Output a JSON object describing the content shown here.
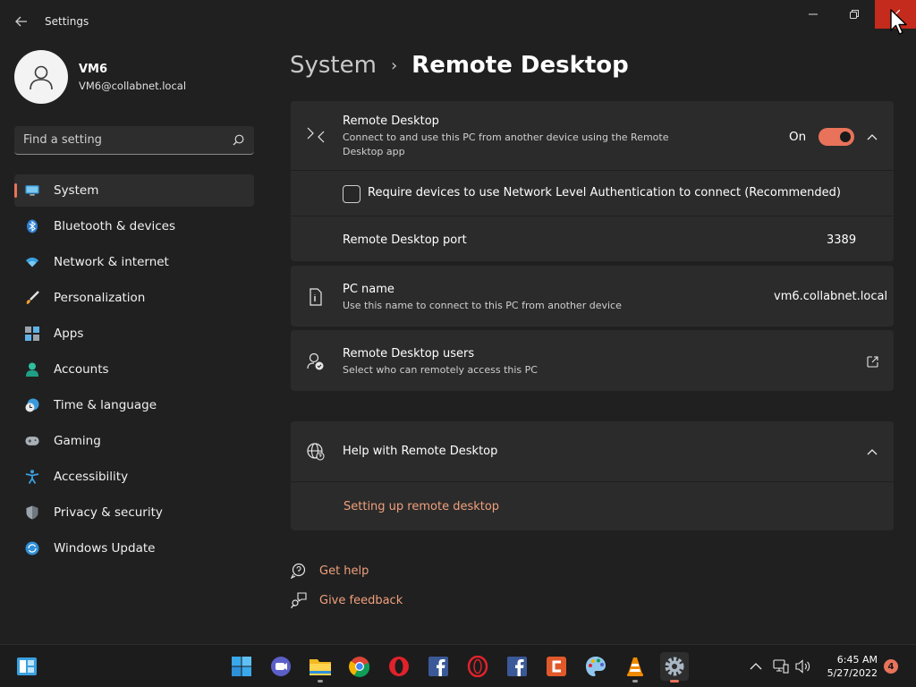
{
  "window": {
    "title": "Settings",
    "back_icon": "arrow-left-icon",
    "minimize_icon": "minimize-icon",
    "maximize_icon": "restore-icon",
    "close_icon": "close-icon"
  },
  "profile": {
    "name": "VM6",
    "email": "VM6@collabnet.local",
    "avatar_icon": "person-icon"
  },
  "search": {
    "placeholder": "Find a setting",
    "icon": "search-icon"
  },
  "sidebar": {
    "items": [
      {
        "label": "System",
        "icon": "monitor-icon",
        "active": true
      },
      {
        "label": "Bluetooth & devices",
        "icon": "bluetooth-icon"
      },
      {
        "label": "Network & internet",
        "icon": "wifi-icon"
      },
      {
        "label": "Personalization",
        "icon": "brush-icon"
      },
      {
        "label": "Apps",
        "icon": "apps-icon"
      },
      {
        "label": "Accounts",
        "icon": "account-icon"
      },
      {
        "label": "Time & language",
        "icon": "clock-globe-icon"
      },
      {
        "label": "Gaming",
        "icon": "gamepad-icon"
      },
      {
        "label": "Accessibility",
        "icon": "accessibility-icon"
      },
      {
        "label": "Privacy & security",
        "icon": "shield-icon"
      },
      {
        "label": "Windows Update",
        "icon": "update-icon"
      }
    ]
  },
  "breadcrumb": {
    "parent": "System",
    "separator": "›",
    "current": "Remote Desktop"
  },
  "remote_desktop": {
    "title": "Remote Desktop",
    "subtitle": "Connect to and use this PC from another device using the Remote Desktop app",
    "toggle_label": "On",
    "toggle_on": true,
    "nla_label": "Require devices to use Network Level Authentication to connect (Recommended)",
    "nla_checked": false,
    "port_label": "Remote Desktop port",
    "port_value": "3389"
  },
  "pc_name": {
    "title": "PC name",
    "subtitle": "Use this name to connect to this PC from another device",
    "value": "vm6.collabnet.local"
  },
  "rd_users": {
    "title": "Remote Desktop users",
    "subtitle": "Select who can remotely access this PC"
  },
  "help": {
    "title": "Help with Remote Desktop",
    "link": "Setting up remote desktop"
  },
  "footer_links": {
    "get_help": "Get help",
    "give_feedback": "Give feedback"
  },
  "taskbar": {
    "apps": [
      {
        "name": "start-icon"
      },
      {
        "name": "widgets-icon"
      },
      {
        "name": "teams-chat-icon"
      },
      {
        "name": "file-explorer-icon"
      },
      {
        "name": "chrome-icon"
      },
      {
        "name": "opera-icon"
      },
      {
        "name": "facebook-icon"
      },
      {
        "name": "opera-gx-icon"
      },
      {
        "name": "facebook-icon"
      },
      {
        "name": "ccleaner-icon"
      },
      {
        "name": "paint-icon"
      },
      {
        "name": "vlc-icon"
      },
      {
        "name": "settings-icon",
        "active": true
      }
    ],
    "time": "6:45 AM",
    "date": "5/27/2022",
    "notification_count": "4"
  },
  "colors": {
    "accent": "#e8735a",
    "background": "#202020",
    "card": "#2b2b2b",
    "link": "#f0a07d",
    "close_button": "#c42b1c"
  }
}
